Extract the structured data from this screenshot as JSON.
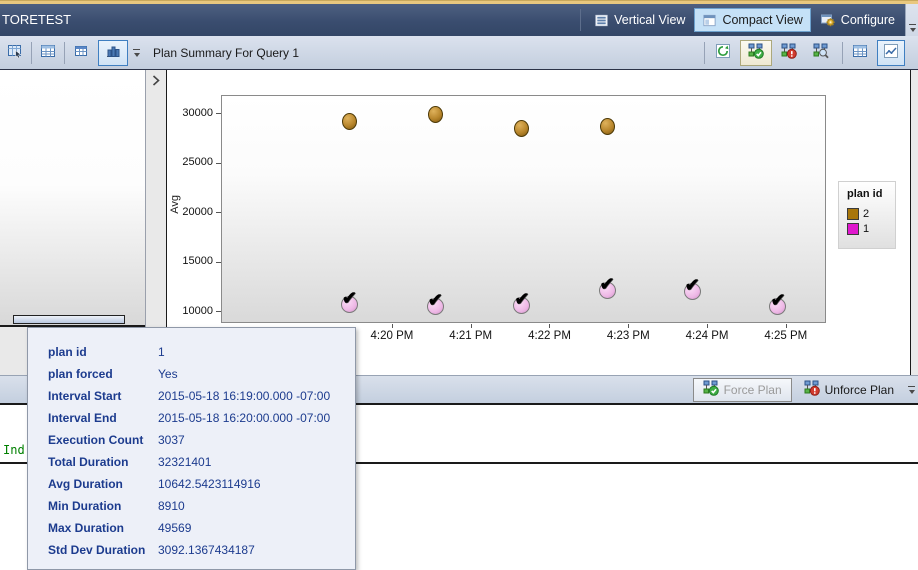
{
  "header": {
    "title": "TORETEST",
    "vertical_view_label": "Vertical View",
    "compact_view_label": "Compact View",
    "configure_label": "Configure"
  },
  "toolbar": {
    "plan_summary_label": "Plan Summary For Query 1",
    "icons": [
      "shrink-plan-grid-icon",
      "grid-view-icon",
      "grid-small-icon",
      "bar-chart-view-icon",
      "refresh-icon",
      "force-plan-icon",
      "unforce-plan-icon",
      "compare-plan-icon",
      "grid-results-icon",
      "chart-results-icon"
    ]
  },
  "force_toolbar": {
    "force_label": "Force Plan",
    "unforce_label": "Unforce Plan"
  },
  "editor": {
    "text": "Ind"
  },
  "tooltip": {
    "rows": [
      {
        "label": "plan id",
        "value": "1"
      },
      {
        "label": "plan forced",
        "value": "Yes"
      },
      {
        "label": "Interval Start",
        "value": "2015-05-18 16:19:00.000 -07:00"
      },
      {
        "label": "Interval End",
        "value": "2015-05-18 16:20:00.000 -07:00"
      },
      {
        "label": "Execution Count",
        "value": "3037"
      },
      {
        "label": "Total Duration",
        "value": "32321401"
      },
      {
        "label": "Avg Duration",
        "value": "10642.5423114916"
      },
      {
        "label": "Min Duration",
        "value": "8910"
      },
      {
        "label": "Max Duration",
        "value": "49569"
      },
      {
        "label": "Std Dev Duration",
        "value": "3092.1367434187"
      }
    ]
  },
  "chart_data": {
    "type": "scatter",
    "title": "",
    "ylabel": "Avg",
    "y_ticks": [
      10000,
      15000,
      20000,
      25000,
      30000
    ],
    "y_domain": [
      8786,
      31862
    ],
    "x_unit": "minutes after 4:19 PM",
    "x_domain": [
      -1.17,
      6.51
    ],
    "x_ticks": [
      {
        "t": 1,
        "label": "4:20 PM"
      },
      {
        "t": 2,
        "label": "4:21 PM"
      },
      {
        "t": 3,
        "label": "4:22 PM"
      },
      {
        "t": 4,
        "label": "4:23 PM"
      },
      {
        "t": 5,
        "label": "4:24 PM"
      },
      {
        "t": 6,
        "label": "4:25 PM"
      }
    ],
    "legend": {
      "title": "plan id",
      "position": "right",
      "entries": [
        {
          "label": "2",
          "color": "#a8760a"
        },
        {
          "label": "1",
          "color": "#e018ce"
        }
      ]
    },
    "series": [
      {
        "name": "2",
        "plan_id": 2,
        "forced": false,
        "marker": "circle",
        "color": "#b8862c",
        "points": [
          {
            "t": 0.46,
            "v": 29150
          },
          {
            "t": 1.55,
            "v": 29900
          },
          {
            "t": 2.65,
            "v": 28500
          },
          {
            "t": 3.73,
            "v": 28650
          }
        ]
      },
      {
        "name": "1",
        "plan_id": 1,
        "forced": true,
        "marker": "circle-check",
        "color": "#eeb8e6",
        "points": [
          {
            "t": 0.46,
            "v": 10642.54
          },
          {
            "t": 1.55,
            "v": 10500
          },
          {
            "t": 2.65,
            "v": 10550
          },
          {
            "t": 3.73,
            "v": 12100
          },
          {
            "t": 4.81,
            "v": 12000
          },
          {
            "t": 5.9,
            "v": 10450
          }
        ]
      }
    ],
    "grid": false
  },
  "colors": {
    "accent_top": "#e9c87f",
    "title_bar": "#3a4d6f",
    "selected_view_button_bg": "#c5e1f7",
    "plan2_marker": "#b8862c",
    "plan1_marker": "#eeb8e6",
    "tooltip_text": "#1c3b8e",
    "editor_text": "#008000"
  }
}
